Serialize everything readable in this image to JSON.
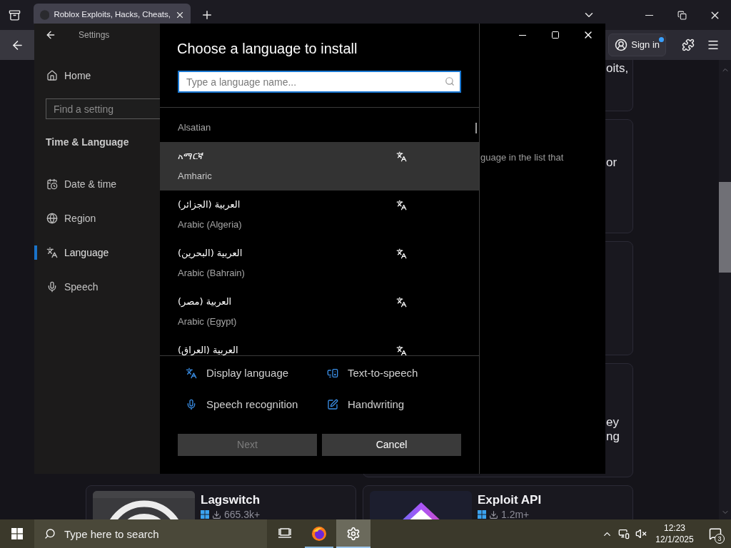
{
  "browser": {
    "tabs": [
      {
        "title": "Roblox Exploits, Hacks, Cheats,",
        "selected": true
      }
    ],
    "toolbar": {
      "sign_in": "Sign in"
    },
    "card_fragments": [
      {
        "text": "oits,"
      },
      {
        "text": "or"
      },
      {
        "text": "ey\nng"
      }
    ],
    "cards": [
      {
        "title": "Lagswitch",
        "downloads": "665.3k+"
      },
      {
        "title": "Exploit API",
        "downloads": "1.2m+"
      }
    ]
  },
  "settings": {
    "title": "Settings",
    "home": "Home",
    "search_placeholder": "Find a setting",
    "section": "Time & Language",
    "items": [
      {
        "label": "Date & time",
        "selected": false
      },
      {
        "label": "Region",
        "selected": false
      },
      {
        "label": "Language",
        "selected": true
      },
      {
        "label": "Speech",
        "selected": false
      }
    ],
    "content_fragment": "guage in the list that"
  },
  "dialog": {
    "title": "Choose a language to install",
    "search": {
      "placeholder": "Type a language name..."
    },
    "languages": [
      {
        "english": "Alsatian",
        "display_language": false,
        "selected": false
      },
      {
        "native": "አማርኛ",
        "english": "Amharic",
        "display_language": true,
        "selected": true
      },
      {
        "native": "العربية (الجزائر)",
        "english": "Arabic (Algeria)",
        "display_language": true,
        "selected": false
      },
      {
        "native": "العربية (البحرين)",
        "english": "Arabic (Bahrain)",
        "display_language": true,
        "selected": false
      },
      {
        "native": "العربية (مصر)",
        "english": "Arabic (Egypt)",
        "display_language": true,
        "selected": false
      },
      {
        "native": "العربية (العراق)",
        "display_language": true,
        "selected": false
      }
    ],
    "features": [
      {
        "label": "Display language"
      },
      {
        "label": "Text-to-speech"
      },
      {
        "label": "Speech recognition"
      },
      {
        "label": "Handwriting"
      }
    ],
    "buttons": [
      {
        "label": "Next",
        "disabled": true
      },
      {
        "label": "Cancel",
        "disabled": false
      }
    ]
  },
  "taskbar": {
    "search_placeholder": "Type here to search",
    "apps": [
      {
        "kind": "task_view",
        "running": false,
        "active": false
      },
      {
        "kind": "browser",
        "running": true,
        "active": false
      },
      {
        "kind": "settings",
        "running": true,
        "active": true
      }
    ],
    "time": "12:23",
    "date": "12/1/2025",
    "notifications": "3"
  }
}
